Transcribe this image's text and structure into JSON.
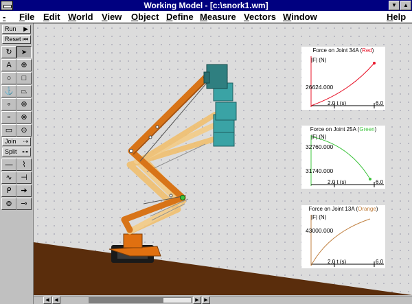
{
  "window": {
    "title": "Working Model - [c:\\snork1.wm]",
    "controls": {
      "minimize": "▼",
      "maximize": "▲"
    }
  },
  "menu": {
    "items": [
      "File",
      "Edit",
      "World",
      "View",
      "Object",
      "Define",
      "Measure",
      "Vectors",
      "Window",
      "Help"
    ]
  },
  "toolbar": {
    "run_label": "Run",
    "reset_label": "Reset",
    "join_label": "Join",
    "split_label": "Split"
  },
  "tools": {
    "rotate": "↻",
    "pointer": "▲",
    "text": "A",
    "zoom": "⊕",
    "circle": "○",
    "rectangle": "□",
    "anchor": "⚓",
    "polygon": "⬠",
    "point": "∘",
    "search": "⌕"
  },
  "meters": [
    {
      "title_prefix": "Force on Joint 34A (",
      "title_color_name": "Red",
      "title_suffix": ")",
      "color": "#e8142a",
      "y_label": "|F| (N)",
      "values": [
        "26624.000"
      ],
      "t_label": "2.0 t (s)",
      "t_max": "6.0"
    },
    {
      "title_prefix": "Force on Joint 25A (",
      "title_color_name": "Green",
      "title_suffix": ")",
      "color": "#3ec43e",
      "y_label": "|F| (N)",
      "values": [
        "32760.000",
        "31740.000"
      ],
      "t_label": "2.0 t (s)",
      "t_max": "6.0"
    },
    {
      "title_prefix": "Force on Joint 13A (",
      "title_color_name": "Orange",
      "title_suffix": ")",
      "color": "#c08040",
      "y_label": "|F| (N)",
      "values": [
        "43000.000"
      ],
      "t_label": "2.0 t (s)",
      "t_max": "6.0"
    }
  ],
  "colors": {
    "titlebar": "#000080",
    "ground": "#5a2d0c",
    "boom_orange": "#d87418",
    "boom_light": "#f0c070",
    "bucket": "#2f7f80",
    "bucket_light": "#3aa3a5",
    "base_orange": "#e07010",
    "tires": "#1a1a1a"
  }
}
